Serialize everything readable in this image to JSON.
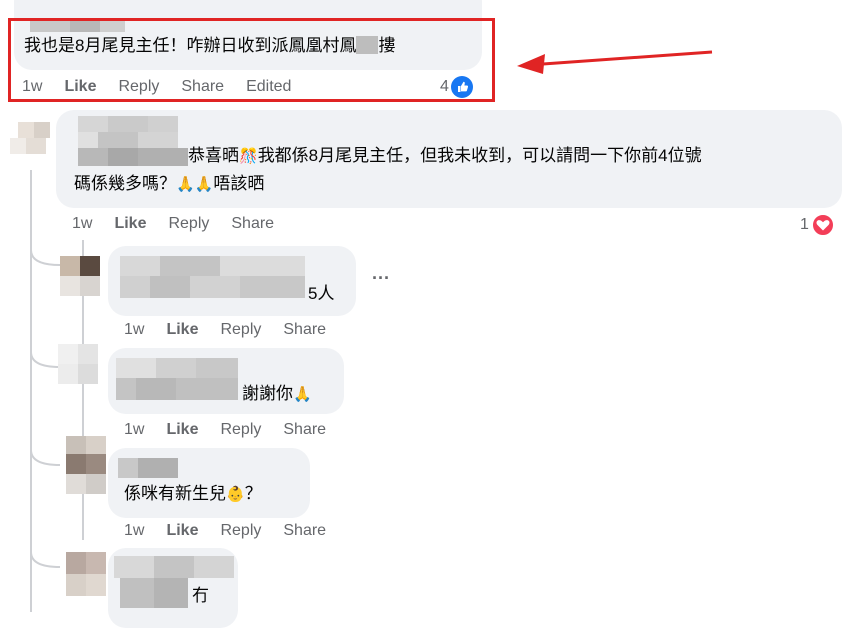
{
  "comment_top": {
    "text": "我也是8月尾見主任！咋辦日收到派鳳凰村鳳",
    "text_tail": "摟",
    "time": "1w",
    "like": "Like",
    "reply": "Reply",
    "share": "Share",
    "edited": "Edited",
    "reaction_count": "4",
    "reaction_icon": "thumbs-up-icon",
    "highlight_color": "#e02424"
  },
  "reply_1": {
    "text_line1_pre": "恭喜晒",
    "text_line1_emoji": "🎊",
    "text_line1_post": "我都係8月尾見主任，但我未收到，可以請問一下你前4位號",
    "text_line2_pre": "碼係幾多嗎？",
    "text_line2_emoji": "🙏🙏",
    "text_line2_post": "唔該晒",
    "time": "1w",
    "like": "Like",
    "reply": "Reply",
    "share": "Share",
    "reaction_count": "1",
    "reaction_icon": "heart-icon"
  },
  "reply_2": {
    "text": "5人",
    "more": "···",
    "time": "1w",
    "like": "Like",
    "reply": "Reply",
    "share": "Share"
  },
  "reply_3": {
    "text": "謝謝你",
    "emoji": "🙏",
    "time": "1w",
    "like": "Like",
    "reply": "Reply",
    "share": "Share"
  },
  "reply_4": {
    "text": "係咪有新生兒",
    "emoji": "👶",
    "text_tail": "？",
    "time": "1w",
    "like": "Like",
    "reply": "Reply",
    "share": "Share"
  },
  "reply_5": {
    "text": "冇"
  },
  "colors": {
    "bubble": "#f0f2f5",
    "meta": "#65676b",
    "like_blue": "#1877f2",
    "heart_red": "#f33e58",
    "arrow_red": "#e02424"
  }
}
